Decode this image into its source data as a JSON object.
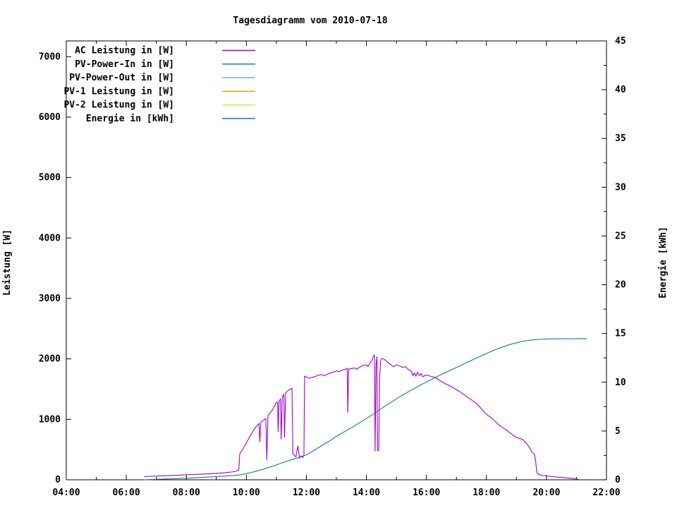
{
  "title": "Tagesdiagramm vom 2010-07-18",
  "colors": {
    "foreground": "#000000",
    "background": "#ffffff",
    "ac": "#a000d0",
    "pv_power_in": "#00a080",
    "pv_power_out": "#62b8e8",
    "pv1": "#e0a200",
    "pv2": "#e8e03a",
    "energie": "#1276a8"
  },
  "legend": {
    "position": "top-left-inside",
    "items": [
      {
        "label": "AC Leistung in [W]",
        "color_key": "ac"
      },
      {
        "label": "PV-Power-In in [W]",
        "color_key": "pv_power_in"
      },
      {
        "label": "PV-Power-Out in [W]",
        "color_key": "pv_power_out"
      },
      {
        "label": "PV-1 Leistung in [W]",
        "color_key": "pv1"
      },
      {
        "label": "PV-2 Leistung in [W]",
        "color_key": "pv2"
      },
      {
        "label": "Energie in [kWh]",
        "color_key": "energie"
      }
    ]
  },
  "axes": {
    "x": {
      "range_hours": [
        4,
        22
      ],
      "major_tick_hours": [
        4,
        6,
        8,
        10,
        12,
        14,
        16,
        18,
        20,
        22
      ],
      "major_tick_labels": [
        "04:00",
        "06:00",
        "08:00",
        "10:00",
        "12:00",
        "14:00",
        "16:00",
        "18:00",
        "20:00",
        "22:00"
      ],
      "minor_tick_step_hours": 1
    },
    "y_left": {
      "label": "Leistung [W]",
      "range": [
        0,
        7260
      ],
      "tick_values": [
        0,
        1000,
        2000,
        3000,
        4000,
        5000,
        6000,
        7000
      ],
      "tick_labels": [
        "0",
        "1000",
        "2000",
        "3000",
        "4000",
        "5000",
        "6000",
        "7000"
      ]
    },
    "y_right": {
      "label": "Energie [kWh]",
      "range": [
        0,
        45
      ],
      "tick_values": [
        0,
        5,
        10,
        15,
        20,
        25,
        30,
        35,
        40,
        45
      ],
      "tick_labels": [
        "0",
        "5",
        "10",
        "15",
        "20",
        "25",
        "30",
        "35",
        "40",
        "45"
      ],
      "minor_tick_step": 2.5
    }
  },
  "chart_data": {
    "type": "line",
    "title": "Tagesdiagramm vom 2010-07-18",
    "x_unit": "hour-of-day",
    "xlim": [
      4,
      22
    ],
    "ylim_left": [
      0,
      7260
    ],
    "ylim_right": [
      0,
      45
    ],
    "grid": false,
    "legend_position": "top-left",
    "series": [
      {
        "name": "AC Leistung in [W]",
        "axis": "left",
        "color_key": "ac",
        "plotted": true,
        "points": [
          [
            6.6,
            50
          ],
          [
            6.8,
            58
          ],
          [
            7.0,
            62
          ],
          [
            7.3,
            66
          ],
          [
            7.6,
            72
          ],
          [
            7.9,
            80
          ],
          [
            8.2,
            88
          ],
          [
            8.5,
            94
          ],
          [
            8.8,
            100
          ],
          [
            9.1,
            108
          ],
          [
            9.3,
            118
          ],
          [
            9.5,
            128
          ],
          [
            9.65,
            140
          ],
          [
            9.75,
            165
          ],
          [
            9.78,
            430
          ],
          [
            9.9,
            520
          ],
          [
            10.0,
            610
          ],
          [
            10.1,
            700
          ],
          [
            10.2,
            790
          ],
          [
            10.3,
            865
          ],
          [
            10.42,
            930
          ],
          [
            10.45,
            620
          ],
          [
            10.48,
            950
          ],
          [
            10.58,
            990
          ],
          [
            10.65,
            1010
          ],
          [
            10.68,
            330
          ],
          [
            10.72,
            1060
          ],
          [
            10.8,
            1110
          ],
          [
            10.9,
            1180
          ],
          [
            11.0,
            1280
          ],
          [
            11.04,
            1285
          ],
          [
            11.06,
            790
          ],
          [
            11.09,
            1305
          ],
          [
            11.14,
            1335
          ],
          [
            11.16,
            665
          ],
          [
            11.2,
            1380
          ],
          [
            11.25,
            1410
          ],
          [
            11.27,
            700
          ],
          [
            11.31,
            1440
          ],
          [
            11.38,
            1470
          ],
          [
            11.45,
            1495
          ],
          [
            11.52,
            1510
          ],
          [
            11.55,
            430
          ],
          [
            11.6,
            400
          ],
          [
            11.65,
            380
          ],
          [
            11.72,
            560
          ],
          [
            11.77,
            360
          ],
          [
            11.83,
            395
          ],
          [
            11.88,
            370
          ],
          [
            11.92,
            410
          ],
          [
            11.94,
            1715
          ],
          [
            12.0,
            1700
          ],
          [
            12.1,
            1680
          ],
          [
            12.2,
            1695
          ],
          [
            12.3,
            1710
          ],
          [
            12.4,
            1730
          ],
          [
            12.5,
            1740
          ],
          [
            12.6,
            1720
          ],
          [
            12.7,
            1750
          ],
          [
            12.8,
            1765
          ],
          [
            12.9,
            1780
          ],
          [
            13.0,
            1800
          ],
          [
            13.1,
            1790
          ],
          [
            13.2,
            1815
          ],
          [
            13.3,
            1830
          ],
          [
            13.36,
            1840
          ],
          [
            13.38,
            1110
          ],
          [
            13.41,
            1830
          ],
          [
            13.5,
            1840
          ],
          [
            13.6,
            1850
          ],
          [
            13.68,
            1830
          ],
          [
            13.78,
            1865
          ],
          [
            13.88,
            1890
          ],
          [
            14.0,
            1900
          ],
          [
            14.05,
            1875
          ],
          [
            14.12,
            1930
          ],
          [
            14.18,
            1970
          ],
          [
            14.24,
            2050
          ],
          [
            14.27,
            2065
          ],
          [
            14.29,
            470
          ],
          [
            14.32,
            1900
          ],
          [
            14.35,
            2040
          ],
          [
            14.37,
            490
          ],
          [
            14.41,
            480
          ],
          [
            14.44,
            1700
          ],
          [
            14.48,
            1985
          ],
          [
            14.52,
            2010
          ],
          [
            14.6,
            1990
          ],
          [
            14.7,
            1950
          ],
          [
            14.8,
            1910
          ],
          [
            14.9,
            1870
          ],
          [
            15.0,
            1900
          ],
          [
            15.1,
            1885
          ],
          [
            15.2,
            1860
          ],
          [
            15.3,
            1870
          ],
          [
            15.4,
            1825
          ],
          [
            15.5,
            1790
          ],
          [
            15.55,
            1725
          ],
          [
            15.6,
            1765
          ],
          [
            15.65,
            1715
          ],
          [
            15.7,
            1780
          ],
          [
            15.76,
            1725
          ],
          [
            15.82,
            1755
          ],
          [
            15.88,
            1705
          ],
          [
            15.95,
            1725
          ],
          [
            16.05,
            1730
          ],
          [
            16.15,
            1710
          ],
          [
            16.25,
            1700
          ],
          [
            16.35,
            1675
          ],
          [
            16.45,
            1640
          ],
          [
            16.55,
            1610
          ],
          [
            16.65,
            1585
          ],
          [
            16.75,
            1560
          ],
          [
            16.85,
            1535
          ],
          [
            16.95,
            1505
          ],
          [
            17.05,
            1475
          ],
          [
            17.15,
            1445
          ],
          [
            17.25,
            1410
          ],
          [
            17.35,
            1375
          ],
          [
            17.45,
            1340
          ],
          [
            17.55,
            1305
          ],
          [
            17.65,
            1270
          ],
          [
            17.75,
            1220
          ],
          [
            17.85,
            1165
          ],
          [
            17.95,
            1110
          ],
          [
            18.05,
            1065
          ],
          [
            18.15,
            1030
          ],
          [
            18.25,
            985
          ],
          [
            18.35,
            935
          ],
          [
            18.45,
            895
          ],
          [
            18.55,
            860
          ],
          [
            18.65,
            830
          ],
          [
            18.75,
            790
          ],
          [
            18.85,
            750
          ],
          [
            18.9,
            730
          ],
          [
            19.0,
            700
          ],
          [
            19.1,
            685
          ],
          [
            19.2,
            670
          ],
          [
            19.3,
            620
          ],
          [
            19.4,
            560
          ],
          [
            19.45,
            520
          ],
          [
            19.5,
            470
          ],
          [
            19.55,
            440
          ],
          [
            19.6,
            425
          ],
          [
            19.64,
            300
          ],
          [
            19.68,
            120
          ],
          [
            19.75,
            85
          ],
          [
            19.9,
            70
          ],
          [
            20.1,
            58
          ],
          [
            20.3,
            48
          ],
          [
            20.5,
            40
          ],
          [
            20.7,
            30
          ],
          [
            20.85,
            22
          ],
          [
            21.0,
            12
          ],
          [
            21.08,
            5
          ]
        ]
      },
      {
        "name": "PV-Power-In in [W]",
        "axis": "left",
        "color_key": "pv_power_in",
        "plotted": false,
        "points": []
      },
      {
        "name": "PV-Power-Out in [W]",
        "axis": "left",
        "color_key": "pv_power_out",
        "plotted": false,
        "points": []
      },
      {
        "name": "PV-1 Leistung in [W]",
        "axis": "left",
        "color_key": "pv1",
        "plotted": false,
        "points": []
      },
      {
        "name": "PV-2 Leistung in [W]",
        "axis": "left",
        "color_key": "pv2",
        "plotted": false,
        "points": []
      },
      {
        "name": "Energie in [kWh]",
        "axis": "right",
        "color_key": "energie",
        "plotted": true,
        "points": [
          [
            6.6,
            0.01
          ],
          [
            7.0,
            0.05
          ],
          [
            7.5,
            0.1
          ],
          [
            8.0,
            0.16
          ],
          [
            8.5,
            0.24
          ],
          [
            9.0,
            0.33
          ],
          [
            9.5,
            0.42
          ],
          [
            9.8,
            0.5
          ],
          [
            10.0,
            0.62
          ],
          [
            10.25,
            0.82
          ],
          [
            10.5,
            1.03
          ],
          [
            10.75,
            1.26
          ],
          [
            11.0,
            1.52
          ],
          [
            11.25,
            1.8
          ],
          [
            11.5,
            2.05
          ],
          [
            11.75,
            2.28
          ],
          [
            12.0,
            2.55
          ],
          [
            12.25,
            3.0
          ],
          [
            12.5,
            3.48
          ],
          [
            12.75,
            3.95
          ],
          [
            13.0,
            4.45
          ],
          [
            13.25,
            4.9
          ],
          [
            13.5,
            5.35
          ],
          [
            13.75,
            5.8
          ],
          [
            14.0,
            6.28
          ],
          [
            14.25,
            6.78
          ],
          [
            14.5,
            7.3
          ],
          [
            14.75,
            7.8
          ],
          [
            15.0,
            8.3
          ],
          [
            15.25,
            8.76
          ],
          [
            15.5,
            9.2
          ],
          [
            15.75,
            9.62
          ],
          [
            16.0,
            10.02
          ],
          [
            16.25,
            10.42
          ],
          [
            16.5,
            10.8
          ],
          [
            16.75,
            11.16
          ],
          [
            17.0,
            11.52
          ],
          [
            17.25,
            11.88
          ],
          [
            17.5,
            12.24
          ],
          [
            17.75,
            12.6
          ],
          [
            18.0,
            12.95
          ],
          [
            18.25,
            13.28
          ],
          [
            18.5,
            13.58
          ],
          [
            18.75,
            13.84
          ],
          [
            19.0,
            14.05
          ],
          [
            19.25,
            14.22
          ],
          [
            19.5,
            14.33
          ],
          [
            19.75,
            14.4
          ],
          [
            20.0,
            14.44
          ],
          [
            20.5,
            14.46
          ],
          [
            21.0,
            14.46
          ],
          [
            21.35,
            14.46
          ]
        ]
      }
    ]
  }
}
